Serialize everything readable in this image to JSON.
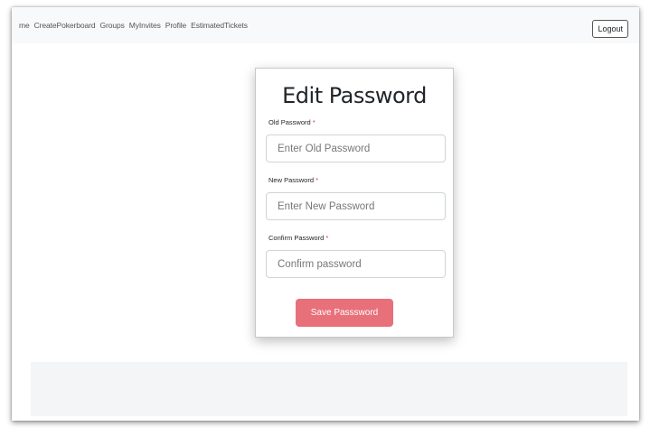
{
  "navbar": {
    "links": [
      "me",
      "CreatePokerboard",
      "Groups",
      "MyInvites",
      "Profile",
      "EstimatedTickets"
    ],
    "logout_label": "Logout"
  },
  "form": {
    "title": "Edit Password",
    "required_marker": "*",
    "old_password": {
      "label": "Old Password",
      "placeholder": "Enter Old Password"
    },
    "new_password": {
      "label": "New Password",
      "placeholder": "Enter New Password"
    },
    "confirm_password": {
      "label": "Confirm Password",
      "placeholder": "Confirm password"
    },
    "save_label": "Save Passsword"
  },
  "colors": {
    "save_button": "#e8707a",
    "required_marker": "#dc3545",
    "navbar_bg": "#f8f9fa"
  }
}
